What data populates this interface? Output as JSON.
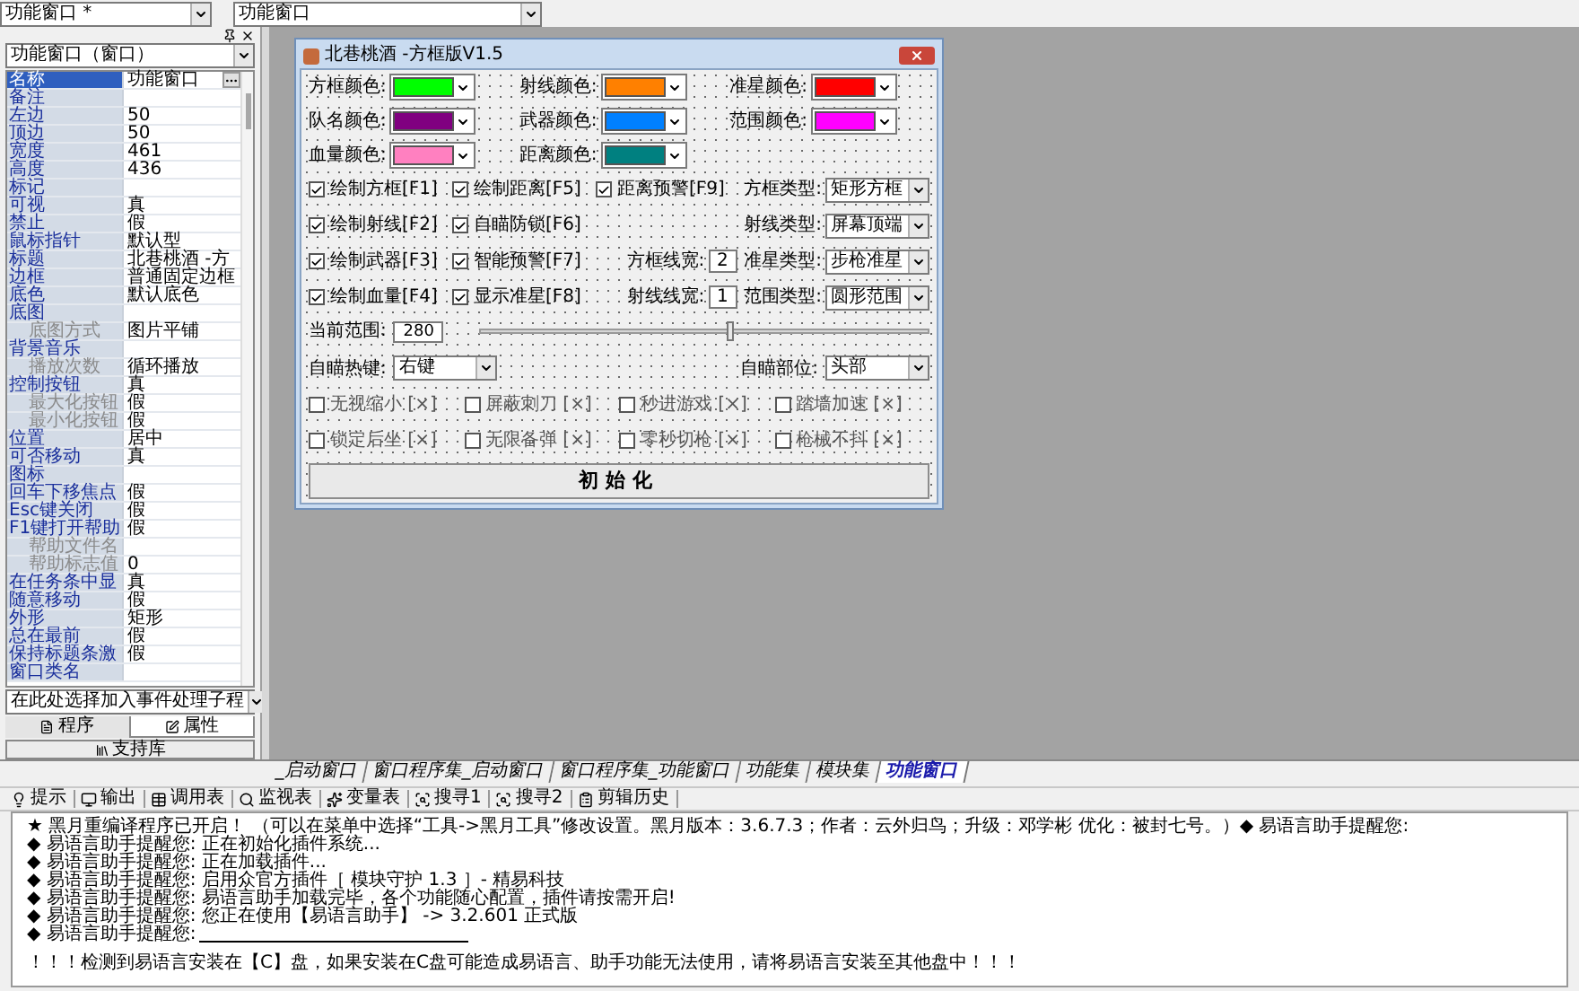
{
  "toolbar": {
    "left_select": "功能窗口 *",
    "right_select": "功能窗口"
  },
  "properties": {
    "object_select": "功能窗口（窗口）",
    "rows": [
      {
        "name": "名称",
        "value": "功能窗口",
        "selected": true
      },
      {
        "name": "备注",
        "selected": false
      },
      {
        "name": "左边",
        "value": "50",
        "selected": false
      },
      {
        "name": "顶边",
        "value": "50",
        "selected": false
      },
      {
        "name": "宽度",
        "value": "461",
        "selected": false
      },
      {
        "name": "高度",
        "value": "436",
        "selected": false
      },
      {
        "name": "标记",
        "selected": false
      },
      {
        "name": "可视",
        "value": "真",
        "selected": false
      },
      {
        "name": "禁止",
        "value": "假",
        "selected": false
      },
      {
        "name": "鼠标指针",
        "value": "默认型",
        "selected": false
      },
      {
        "name": "标题",
        "value": "北巷桃酒 -方",
        "selected": false
      },
      {
        "name": "边框",
        "value": "普通固定边框",
        "selected": false
      },
      {
        "name": "底色",
        "value": "默认底色",
        "selected": false
      },
      {
        "name": "底图",
        "selected": false,
        "children": [
          {
            "name": "底图方式",
            "value": "图片平铺",
            "selected": false
          }
        ]
      },
      {
        "name": "背景音乐",
        "selected": false,
        "children": [
          {
            "name": "播放次数",
            "value": "循环播放",
            "selected": false
          }
        ]
      },
      {
        "name": "控制按钮",
        "value": "真",
        "selected": false,
        "children": [
          {
            "name": "最大化按钮",
            "value": "假",
            "selected": false
          },
          {
            "name": "最小化按钮",
            "value": "假",
            "selected": false
          }
        ]
      },
      {
        "name": "位置",
        "value": "居中",
        "selected": false
      },
      {
        "name": "可否移动",
        "value": "真",
        "selected": false
      },
      {
        "name": "图标",
        "selected": false
      },
      {
        "name": "回车下移焦点",
        "value": "假",
        "selected": false
      },
      {
        "name": "Esc键关闭",
        "value": "假",
        "selected": false
      },
      {
        "name": "F1键打开帮助",
        "value": "假",
        "selected": false,
        "children": [
          {
            "name": "帮助文件名",
            "selected": false
          },
          {
            "name": "帮助标志值",
            "value": "0",
            "selected": false
          }
        ]
      },
      {
        "name": "在任务条中显",
        "value": "真",
        "selected": false
      },
      {
        "name": "随意移动",
        "value": "假",
        "selected": false
      },
      {
        "name": "外形",
        "value": "矩形",
        "selected": false
      },
      {
        "name": "总在最前",
        "value": "假",
        "selected": false
      },
      {
        "name": "保持标题条激",
        "value": "假",
        "selected": false
      },
      {
        "name": "窗口类名",
        "selected": false
      }
    ],
    "event_select": "在此处选择加入事件处理子程",
    "tabs": [
      {
        "label": "程序",
        "selected": false
      },
      {
        "label": "属性",
        "selected": true
      }
    ],
    "library_button": "支持库"
  },
  "form": {
    "title": "北巷桃酒 -方框版V1.5",
    "colors": [
      {
        "label": "方框颜色:",
        "color": "#00ff00"
      },
      {
        "label": "射线颜色:",
        "color": "#ff8000"
      },
      {
        "label": "准星颜色:",
        "color": "#ff0000"
      },
      {
        "label": "队名颜色:",
        "color": "#800080"
      },
      {
        "label": "武器颜色:",
        "color": "#0080ff"
      },
      {
        "label": "范围颜色:",
        "color": "#ff00ff"
      },
      {
        "label": "血量颜色:",
        "color": "#ff80c0"
      },
      {
        "label": "距离颜色:",
        "color": "#008080"
      }
    ],
    "toggle_rows": [
      {
        "checks": [
          {
            "label": "绘制方框[F1]",
            "checked": true
          },
          {
            "label": "绘制距离[F5]",
            "checked": true
          },
          {
            "label": "距离预警[F9]",
            "checked": true
          }
        ],
        "settings": [
          {
            "kind": "select",
            "label": "方框类型:",
            "value": "矩形方框"
          }
        ]
      },
      {
        "checks": [
          {
            "label": "绘制射线[F2]",
            "checked": true
          },
          {
            "label": "自瞄防锁[F6]",
            "checked": true
          }
        ],
        "settings": [
          {
            "kind": "select",
            "label": "射线类型:",
            "value": "屏幕顶端"
          }
        ]
      },
      {
        "checks": [
          {
            "label": "绘制武器[F3]",
            "checked": true
          },
          {
            "label": "智能预警[F7]",
            "checked": true
          }
        ],
        "settings": [
          {
            "kind": "number",
            "label": "方框线宽:",
            "value": "2"
          },
          {
            "kind": "select",
            "label": "准星类型:",
            "value": "步枪准星"
          }
        ]
      },
      {
        "checks": [
          {
            "label": "绘制血量[F4]",
            "checked": true
          },
          {
            "label": "显示准星[F8]",
            "checked": true
          }
        ],
        "settings": [
          {
            "kind": "number",
            "label": "射线线宽:",
            "value": "1"
          },
          {
            "kind": "select",
            "label": "范围类型:",
            "value": "圆形范围"
          }
        ]
      }
    ],
    "range": {
      "label": "当前范围:",
      "value": "280",
      "level": 0.55
    },
    "aim": [
      {
        "label": "自瞄热键:",
        "value": "右键"
      },
      {
        "label": "自瞄部位:",
        "value": "头部"
      }
    ],
    "extras": [
      {
        "label": "无视缩小 [×]",
        "checked": false
      },
      {
        "label": "屏蔽刺刀 [×]",
        "checked": false
      },
      {
        "label": "秒进游戏 [×]",
        "checked": false
      },
      {
        "label": "踏墙加速 [×]",
        "checked": false
      },
      {
        "label": "锁定后坐 [×]",
        "checked": false
      },
      {
        "label": "无限备弹 [×]",
        "checked": false
      },
      {
        "label": "零秒切枪 [×]",
        "checked": false
      },
      {
        "label": "枪械不抖 [×]",
        "checked": false
      }
    ],
    "init_button": "初始化"
  },
  "code_tabs": [
    {
      "label": "_启动窗口",
      "selected": false
    },
    {
      "label": "窗口程序集_启动窗口",
      "selected": false
    },
    {
      "label": "窗口程序集_功能窗口",
      "selected": false
    },
    {
      "label": "功能集",
      "selected": false
    },
    {
      "label": "模块集",
      "selected": false
    },
    {
      "label": "功能窗口",
      "selected": true
    }
  ],
  "output": {
    "tabs": [
      "提示",
      "输出",
      "调用表",
      "监视表",
      "变量表",
      "搜寻1",
      "搜寻2",
      "剪辑历史"
    ],
    "lines": [
      {
        "kind": "message",
        "text": "★ 黑月重编译程序已开启！ （可以在菜单中选择“工具->黑月工具”修改设置。黑月版本：3.6.7.3；作者：云外归鸟；升级：邓学彬 优化：被封七号。）◆ 易语言助手提醒您:"
      },
      {
        "kind": "message",
        "text": "◆ 易语言助手提醒您: 正在初始化插件系统..."
      },
      {
        "kind": "message",
        "text": "◆ 易语言助手提醒您: 正在加载插件..."
      },
      {
        "kind": "message",
        "text": "◆ 易语言助手提醒您: 启用众官方插件［ 模块守护 1.3 ］- 精易科技"
      },
      {
        "kind": "message",
        "text": "◆ 易语言助手提醒您: 易语言助手加载完毕，各个功能随心配置，插件请按需开启!"
      },
      {
        "kind": "message",
        "text": "◆ 易语言助手提醒您: 您正在使用【易语言助手】 -> 3.2.601 正式版"
      },
      {
        "kind": "rule",
        "text": "◆ 易语言助手提醒您:"
      },
      {
        "kind": "warning",
        "text": "！！！检测到易语言安装在【C】盘，如果安装在C盘可能造成易语言、助手功能无法使用，请将易语言安装至其他盘中！！！"
      }
    ]
  }
}
